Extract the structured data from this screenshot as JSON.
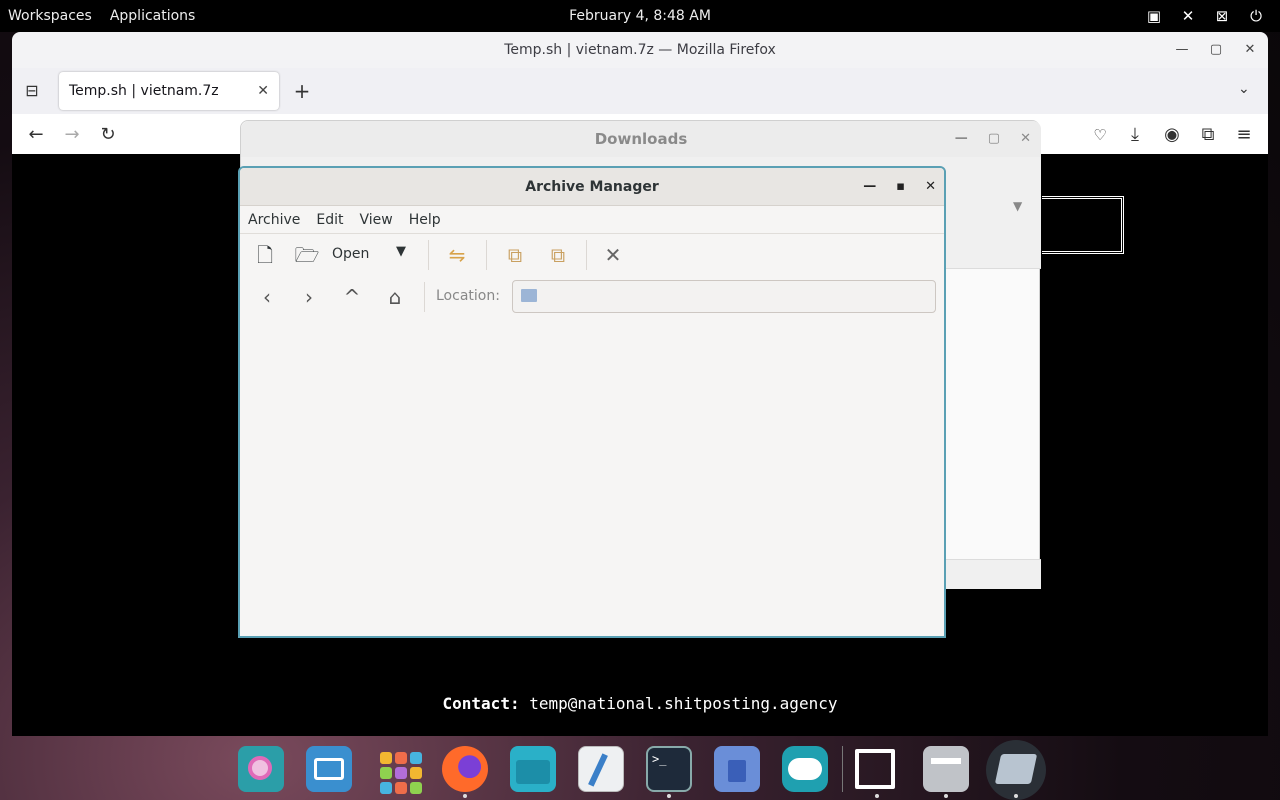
{
  "topbar": {
    "workspaces": "Workspaces",
    "applications": "Applications",
    "clock": "February 4, 8:48 AM",
    "tray_icons": [
      "display-icon",
      "mute-icon",
      "network-off-icon",
      "power-icon"
    ]
  },
  "firefox": {
    "window_title": "Temp.sh | vietnam.7z — Mozilla Firefox",
    "tab_label": "Temp.sh | vietnam.7z",
    "contact_label": "Contact:",
    "contact_email": "temp@national.shitposting.agency"
  },
  "downloads": {
    "title": "Downloads"
  },
  "archive_manager": {
    "title": "Archive Manager",
    "menu": [
      "Archive",
      "Edit",
      "View",
      "Help"
    ],
    "toolbar": {
      "open_label": "Open"
    },
    "location_label": "Location:",
    "location_value": ""
  },
  "dock": {
    "apps": [
      "search-app",
      "multitasking-app",
      "app-grid",
      "firefox",
      "files",
      "text-editor",
      "terminal",
      "software-installer",
      "toggle-settings",
      "screenshot-tool",
      "file-manager",
      "archive-manager"
    ]
  },
  "colors": {
    "accent_border": "#5aa0b4",
    "topbar_bg": "#000000"
  }
}
